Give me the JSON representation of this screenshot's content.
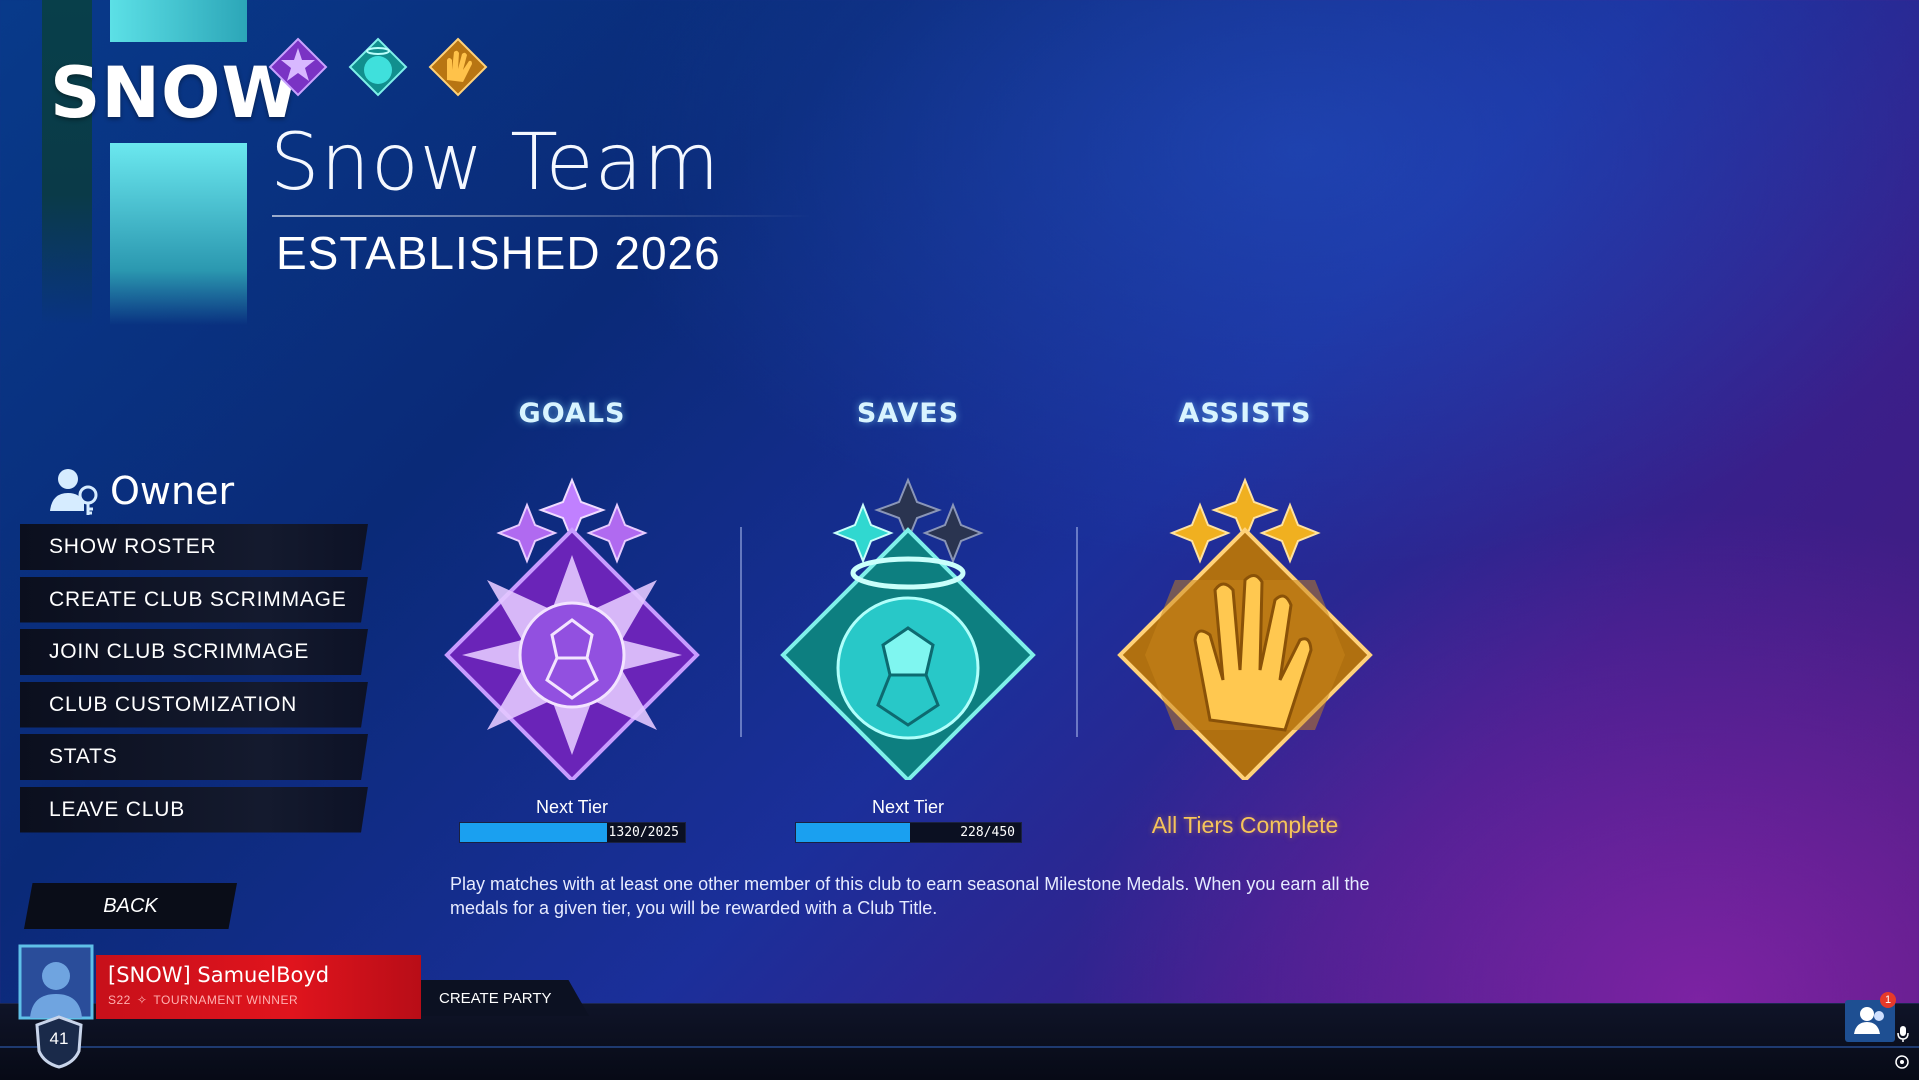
{
  "club": {
    "tag": "SNOW",
    "name": "Snow Team",
    "established": "ESTABLISHED 2026",
    "banner_colors": [
      "#0a3a48",
      "#5ce0e6"
    ]
  },
  "role": {
    "label": "Owner",
    "icon": "owner-key-icon"
  },
  "menu": {
    "items": [
      {
        "label": "SHOW ROSTER"
      },
      {
        "label": "CREATE CLUB SCRIMMAGE"
      },
      {
        "label": "JOIN CLUB SCRIMMAGE"
      },
      {
        "label": "CLUB CUSTOMIZATION"
      },
      {
        "label": "STATS"
      },
      {
        "label": "LEAVE CLUB"
      }
    ],
    "back_label": "BACK"
  },
  "medals": {
    "goals": {
      "title": "GOALS",
      "tier_label": "Next Tier",
      "progress_text": "1320/2025",
      "progress_fraction": 0.652,
      "color": "#8a3fd4",
      "stars_filled": 3
    },
    "saves": {
      "title": "SAVES",
      "tier_label": "Next Tier",
      "progress_text": "228/450",
      "progress_fraction": 0.507,
      "color": "#1fc6c0",
      "stars_filled": 1
    },
    "assists": {
      "title": "ASSISTS",
      "complete_label": "All Tiers Complete",
      "color": "#e6a21c",
      "stars_filled": 3
    }
  },
  "description": "Play matches with at least one other member of this club to earn seasonal Milestone Medals. When you earn all the medals for a given tier, you will be rewarded with a Club Title.",
  "player": {
    "name": "[SNOW] SamuelBoyd",
    "season": "S22",
    "title": "TOURNAMENT WINNER",
    "level": "41"
  },
  "party": {
    "create_label": "CREATE PARTY"
  },
  "friends": {
    "notification_count": "1"
  }
}
